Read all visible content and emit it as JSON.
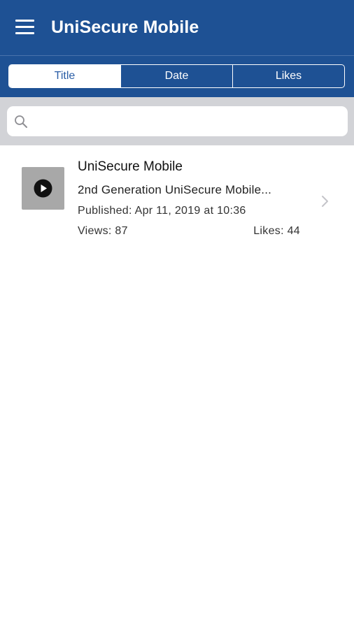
{
  "header": {
    "title": "UniSecure Mobile",
    "menu_icon": "hamburger-menu-icon",
    "background": "#1e5194"
  },
  "sort_tabs": [
    {
      "label": "Title",
      "active": true
    },
    {
      "label": "Date",
      "active": false
    },
    {
      "label": "Likes",
      "active": false
    }
  ],
  "search": {
    "placeholder": "",
    "value": "",
    "icon": "search-icon"
  },
  "videos": [
    {
      "thumbnail_icon": "play-icon",
      "title": "UniSecure Mobile",
      "description": "2nd Generation UniSecure Mobile...",
      "published_label": "Published:",
      "published_date": "Apr 11, 2019",
      "published_sep": "at",
      "published_time": "10:36",
      "views_label": "Views:",
      "views": "87",
      "likes_label": "Likes:",
      "likes": "44",
      "chevron_icon": "chevron-right-icon"
    }
  ]
}
